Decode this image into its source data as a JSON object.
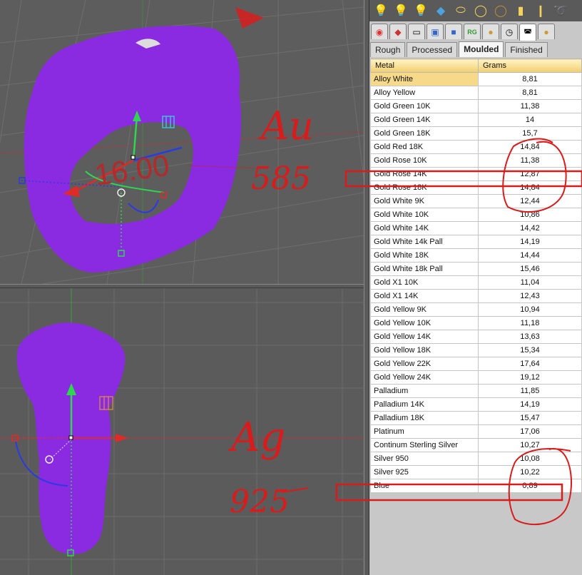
{
  "toolbar": {
    "icons": [
      "bulb-icon",
      "bulb-icon",
      "bulb-icon",
      "lens-icon",
      "ring-icon",
      "ring-icon",
      "ring-icon",
      "pendant-icon",
      "pendant-icon",
      "swirl-icon"
    ]
  },
  "icon_tabs": [
    "color-wheel-icon",
    "render-icon",
    "monitor-icon",
    "window-icon",
    "cube-icon",
    "rg-icon",
    "sphere-icon",
    "clock-icon",
    "ring-weight-icon",
    "gold-ball-icon"
  ],
  "tabs": [
    "Rough",
    "Processed",
    "Moulded",
    "Finished"
  ],
  "active_tab": "Moulded",
  "table": {
    "headers": [
      "Metal",
      "Grams"
    ],
    "rows": [
      {
        "metal": "Alloy White",
        "grams": "8,81"
      },
      {
        "metal": "Alloy Yellow",
        "grams": "8,81"
      },
      {
        "metal": "Gold Green 10K",
        "grams": "11,38"
      },
      {
        "metal": "Gold Green 14K",
        "grams": "14"
      },
      {
        "metal": "Gold Green 18K",
        "grams": "15,7"
      },
      {
        "metal": "Gold Red 18K",
        "grams": "14,84"
      },
      {
        "metal": "Gold Rose 10K",
        "grams": "11,38"
      },
      {
        "metal": "Gold Rose 14K",
        "grams": "12,87"
      },
      {
        "metal": "Gold Rose 18K",
        "grams": "14,84"
      },
      {
        "metal": "Gold White 9K",
        "grams": "12,44"
      },
      {
        "metal": "Gold White 10K",
        "grams": "10,86"
      },
      {
        "metal": "Gold White 14K",
        "grams": "14,42"
      },
      {
        "metal": "Gold White 14k Pall",
        "grams": "14,19"
      },
      {
        "metal": "Gold White 18K",
        "grams": "14,44"
      },
      {
        "metal": "Gold White 18k Pall",
        "grams": "15,46"
      },
      {
        "metal": "Gold X1 10K",
        "grams": "11,04"
      },
      {
        "metal": "Gold X1 14K",
        "grams": "12,43"
      },
      {
        "metal": "Gold Yellow 9K",
        "grams": "10,94"
      },
      {
        "metal": "Gold Yellow 10K",
        "grams": "11,18"
      },
      {
        "metal": "Gold Yellow 14K",
        "grams": "13,63"
      },
      {
        "metal": "Gold Yellow 18K",
        "grams": "15,34"
      },
      {
        "metal": "Gold Yellow 22K",
        "grams": "17,64"
      },
      {
        "metal": "Gold Yellow 24K",
        "grams": "19,12"
      },
      {
        "metal": "Palladium",
        "grams": "11,85"
      },
      {
        "metal": "Palladium 14K",
        "grams": "14,19"
      },
      {
        "metal": "Palladium 18K",
        "grams": "15,47"
      },
      {
        "metal": "Platinum",
        "grams": "17,06"
      },
      {
        "metal": "Continum Sterling Silver",
        "grams": "10,27"
      },
      {
        "metal": "Silver 950",
        "grams": "10,08"
      },
      {
        "metal": "Silver 925",
        "grams": "10,22"
      },
      {
        "metal": "Blue",
        "grams": "0,89"
      }
    ]
  },
  "viewport": {
    "dimension_label": "16.00"
  },
  "annotations": {
    "gold_symbol": "Au",
    "gold_fineness": "585",
    "silver_symbol": "Ag",
    "silver_fineness": "925",
    "ink_color": "#d81c1c"
  },
  "colors": {
    "model_fill": "#8a2be2",
    "axis_green": "#2fd64f",
    "axis_red": "#e02a2a",
    "axis_blue": "#2a3be0",
    "selected_row": "#f7d98a"
  }
}
